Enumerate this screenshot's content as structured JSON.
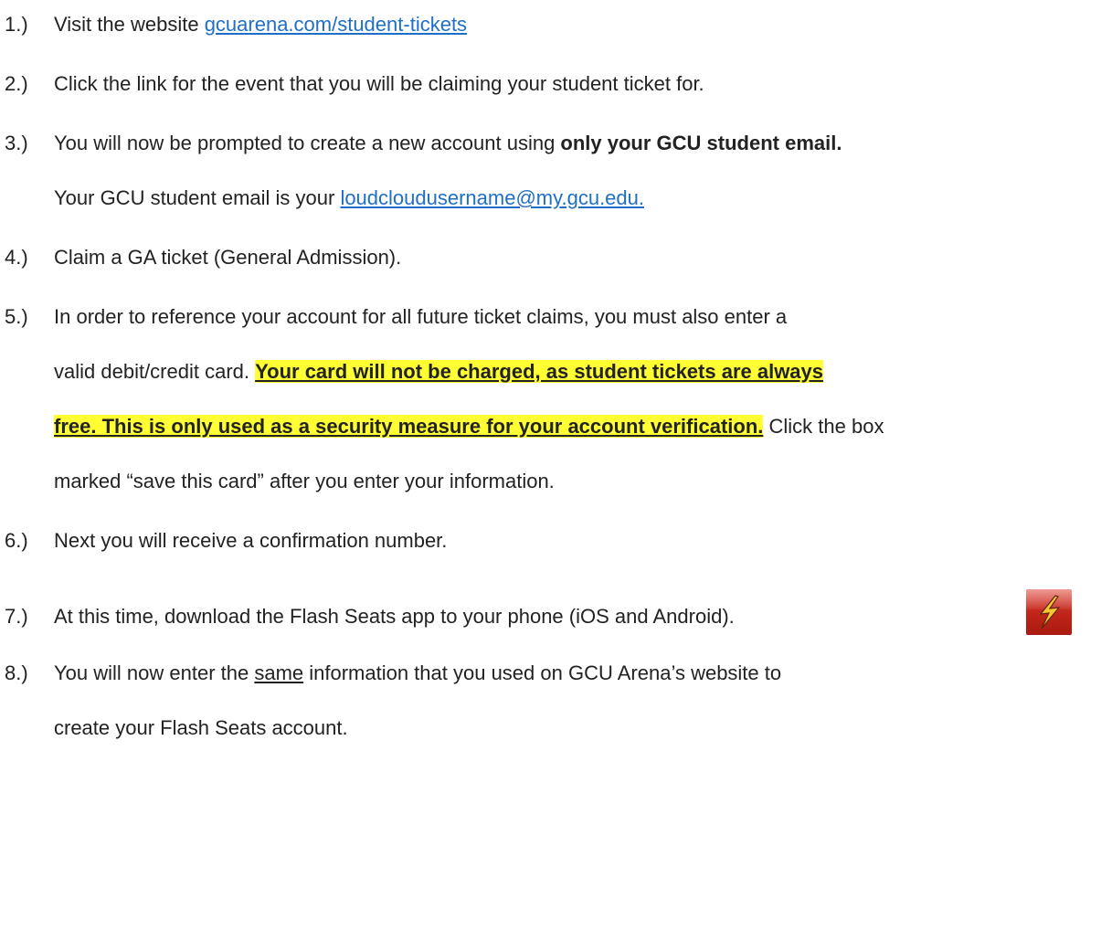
{
  "steps": [
    {
      "num": "1.)",
      "pre": "Visit the website ",
      "link": "gcuarena.com/student-tickets"
    },
    {
      "num": "2.)",
      "text": "Click the link for the event that you will be claiming your student ticket for."
    },
    {
      "num": "3.)",
      "pre": "You will now be prompted  to create a new account using ",
      "bold": "only your GCU student email.",
      "line2_pre": "Your GCU student email is your ",
      "line2_link": "loudcloudusername@my.gcu.edu."
    },
    {
      "num": "4.)",
      "text": "Claim a GA ticket (General Admission)."
    },
    {
      "num": "5.)",
      "line1": "In order to reference your account for all future ticket claims, you must also enter a",
      "line2_pre": "valid debit/credit card.  ",
      "line2_hl": "Your card will not be charged, as student tickets are always",
      "line3_hl": "free. This is only used as a security measure for your account verification.",
      "line3_post": " Click the box",
      "line4": "marked “save this card” after you enter your information."
    },
    {
      "num": "6.)",
      "text": "Next you will receive a confirmation  number."
    },
    {
      "num": "7.)",
      "text": "At this time, download the  Flash Seats app to your phone (iOS and Android).",
      "icon": "flash-seats-app-icon"
    },
    {
      "num": "8.)",
      "pre": "You will now enter the ",
      "underline": "same",
      "post": " information that you used on GCU Arena’s website to",
      "line2": "create your Flash Seats account."
    }
  ],
  "colors": {
    "link": "#1f6fc8",
    "highlight": "#ffff33",
    "text": "#222222"
  }
}
